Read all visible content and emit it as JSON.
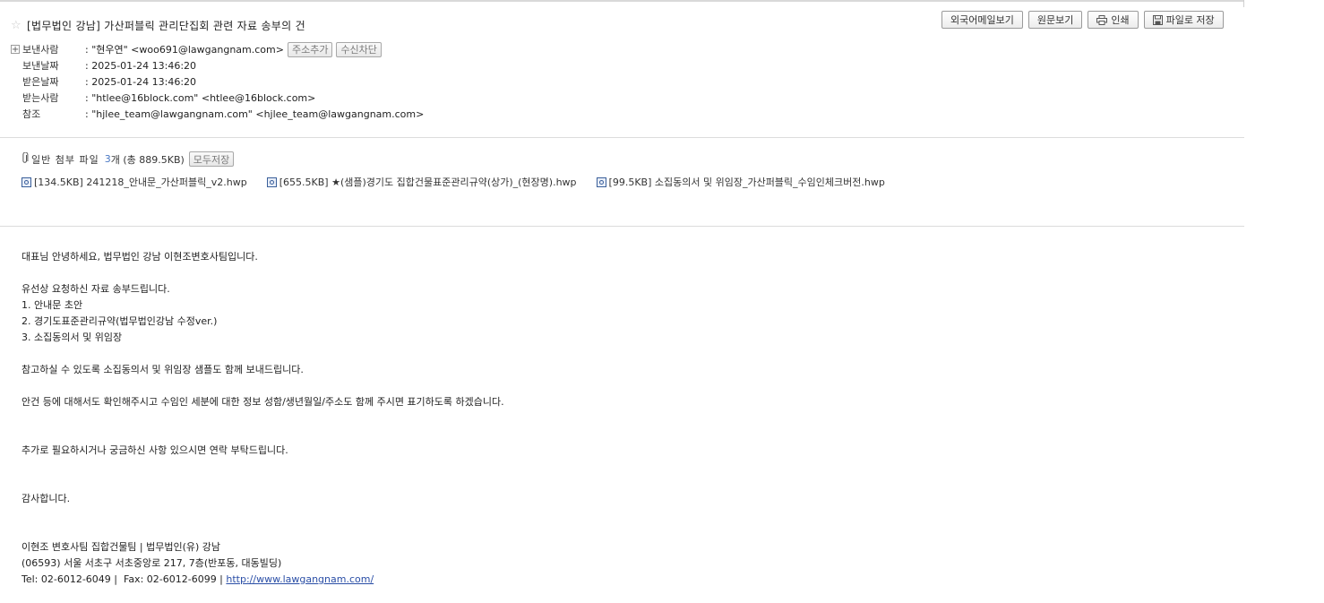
{
  "subject": "[법무법인 강남] 가산퍼블릭 관리단집회 관련 자료 송부의 건",
  "toolbar": {
    "foreign_view": "외국어메일보기",
    "source_view": "원문보기",
    "print": "인쇄",
    "save_file": "파일로 저장"
  },
  "meta": {
    "from_label": "보낸사람",
    "from_value": ": \"현우연\" <woo691@lawgangnam.com>",
    "add_address": "주소추가",
    "block_sender": "수신차단",
    "sent_label": "보낸날짜",
    "sent_value": ": 2025-01-24 13:46:20",
    "received_label": "받은날짜",
    "received_value": ": 2025-01-24 13:46:20",
    "to_label": "받는사람",
    "to_value": ": \"htlee@16block.com\" <htlee@16block.com>",
    "cc_label": "참조",
    "cc_value": ": \"hjlee_team@lawgangnam.com\" <hjlee_team@lawgangnam.com>"
  },
  "attachments": {
    "title": "일반 첨부 파일",
    "count": "3",
    "rest": "개 (총 889.5KB)",
    "save_all": "모두저장",
    "files": [
      "[134.5KB] 241218_안내문_가산퍼블릭_v2.hwp",
      "[655.5KB] ★(샘플)경기도 집합건물표준관리규약(상가)_(현장명).hwp",
      "[99.5KB] 소집동의서 및 위임장_가산퍼블릭_수임인체크버전.hwp"
    ]
  },
  "body": {
    "line1": "대표님 안녕하세요, 법무법인 강남 이현조변호사팀입니다.",
    "line2": "유선상 요청하신 자료 송부드립니다.",
    "line3": "1. 안내문 초안",
    "line4": "2. 경기도표준관리규약(법무법인강남 수정ver.)",
    "line5": "3. 소집동의서 및 위임장",
    "line6": "참고하실 수 있도록 소집동의서 및 위임장 샘플도 함께 보내드립니다.",
    "line7": "안건 등에 대해서도 확인해주시고 수임인 세분에 대한 정보 성함/생년월일/주소도 함께 주시면 표기하도록 하겠습니다.",
    "line8": "추가로 필요하시거나 궁금하신 사항 있으시면 연락 부탁드립니다.",
    "line9": "감사합니다.",
    "sig1": "이현조 변호사팀 집합건물팀 | 법무법인(유) 강남",
    "sig2": "(06593) 서울 서초구 서초중앙로 217, 7층(반포동, 대동빌딩)",
    "sig3": "Tel: 02-6012-6049 |  Fax: 02-6012-6099 | ",
    "sig_link": "http://www.lawgangnam.com/"
  }
}
